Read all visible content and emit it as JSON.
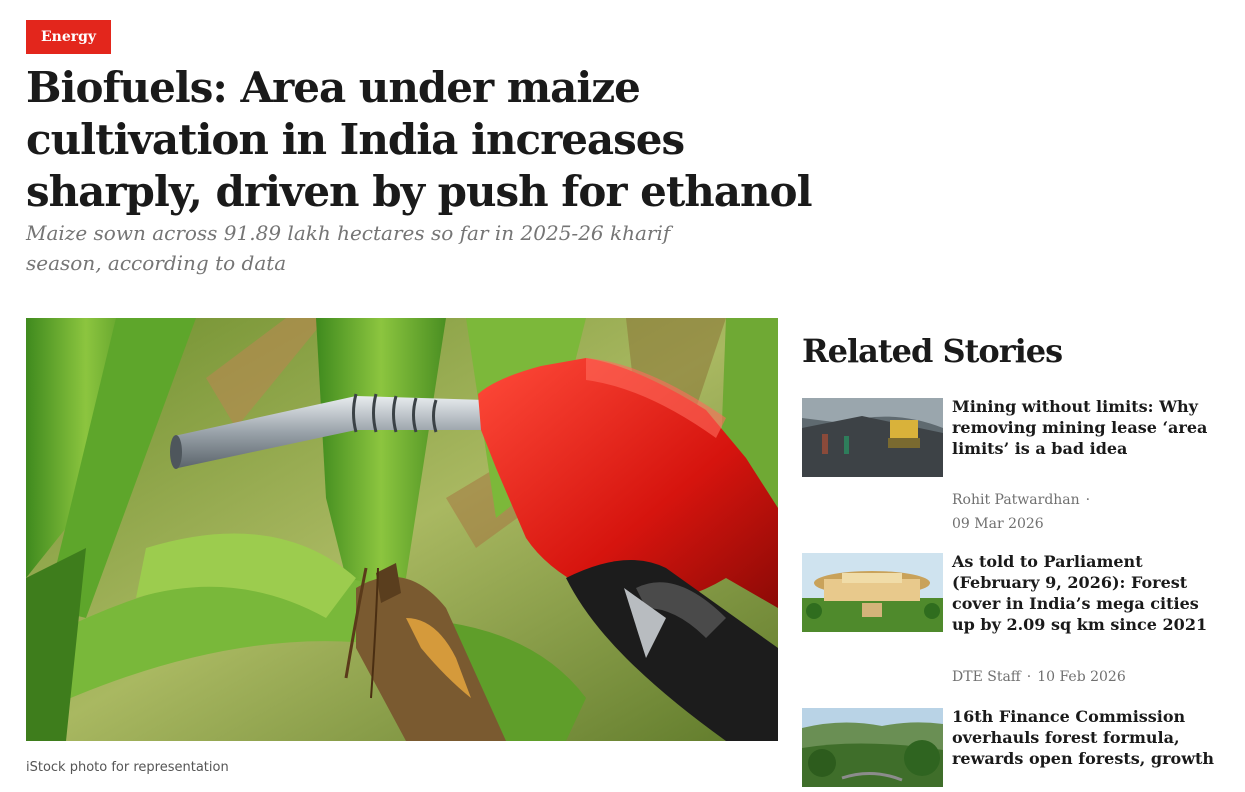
{
  "article": {
    "category": "Energy",
    "headline": "Biofuels: Area under maize cultivation in India increases sharply, driven by push for ethanol",
    "subheadline": "Maize sown across 91.89 lakh hectares so far in 2025-26 kharif season, according to data",
    "image_caption": "iStock photo for representation"
  },
  "related": {
    "title": "Related Stories",
    "stories": [
      {
        "title": "Mining without limits: Why removing mining lease ‘area limits’ is a bad idea",
        "author": "Rohit Patwardhan",
        "separator": "·",
        "date": "09 Mar 2026"
      },
      {
        "title": "As told to Parliament (February 9, 2026): Forest cover in India’s mega cities up by 2.09 sq km since 2021",
        "author": "DTE Staff",
        "separator": "·",
        "date": "10 Feb 2026"
      },
      {
        "title": "16th Finance Commission overhauls forest formula, rewards open forests, growth",
        "author": "",
        "separator": "",
        "date": ""
      }
    ]
  },
  "colors": {
    "accent": "#e3261c",
    "headline": "#1a1a1a",
    "subhead": "#757575",
    "meta": "#707070"
  }
}
